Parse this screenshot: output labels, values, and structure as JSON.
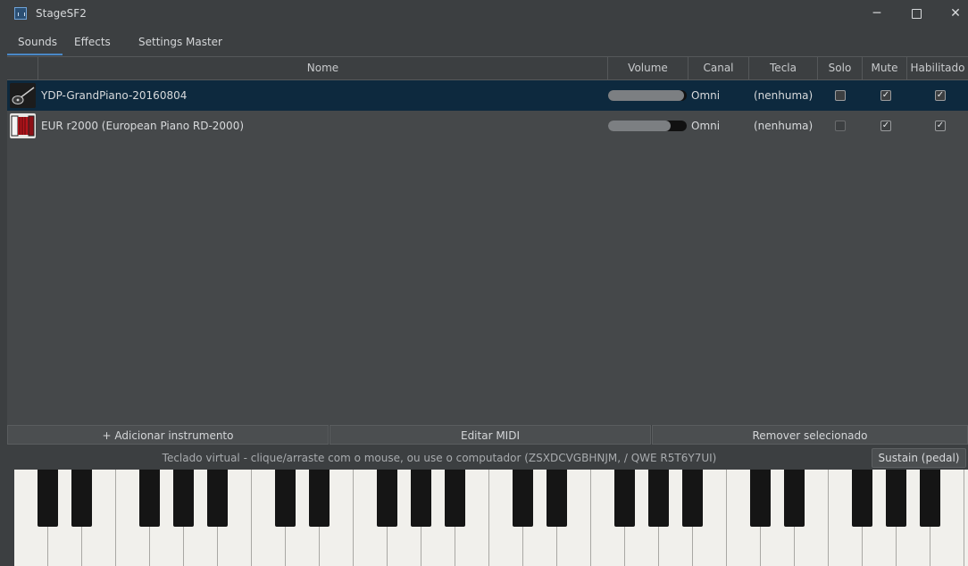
{
  "window": {
    "title": "StageSF2",
    "minimize_glyph": "─",
    "close_glyph": "✕"
  },
  "menu": {
    "items": [
      {
        "label": "Sounds"
      },
      {
        "label": "Effects"
      },
      {
        "label": "Settings"
      },
      {
        "label": "Master"
      }
    ],
    "active": "Sounds"
  },
  "table": {
    "columns": {
      "nome": "Nome",
      "volume": "Volume",
      "canal": "Canal",
      "tecla": "Tecla",
      "solo": "Solo",
      "mute": "Mute",
      "habilitado": "Habilitado"
    },
    "rows": [
      {
        "icon": "guitar-icon",
        "name": "YDP-GrandPiano-20160804",
        "volume_fraction": 0.97,
        "channel": "Omni",
        "key": "(nenhuma)",
        "solo": false,
        "mute": true,
        "enabled": true,
        "selected": true
      },
      {
        "icon": "accordion-icon",
        "name": "EUR r2000 (European Piano RD-2000)",
        "volume_fraction": 0.8,
        "channel": "Omni",
        "key": "(nenhuma)",
        "solo": false,
        "mute": true,
        "enabled": true,
        "selected": false
      }
    ]
  },
  "actions": {
    "add": "+ Adicionar instrumento",
    "edit_midi": "Editar MIDI",
    "remove": "Remover selecionado"
  },
  "keyboard": {
    "hint": "Teclado virtual - clique/arraste com o mouse, ou use o computador (ZSXDCVGBHNJM, / QWE R5T6Y7UI)",
    "sustain": "Sustain (pedal)"
  },
  "colors": {
    "accent": "#4a88c7",
    "selected_row": "#0d293e",
    "background": "#3c3f41"
  }
}
